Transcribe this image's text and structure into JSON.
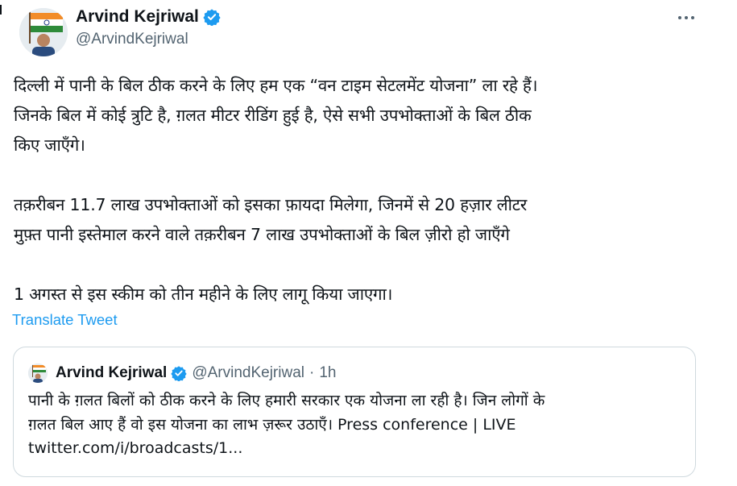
{
  "author": {
    "display_name": "Arvind Kejriwal",
    "handle": "@ArvindKejriwal",
    "verified_icon": "verified-badge-icon"
  },
  "more_icon": "more-options-icon",
  "tweet": {
    "lines": [
      "दिल्ली में पानी के बिल ठीक करने के लिए हम एक “वन टाइम सेटलमेंट योजना” ला रहे हैं।",
      "जिनके बिल में कोई त्रुटि है, ग़लत मीटर रीडिंग हुई है, ऐसे सभी उपभोक्ताओं के बिल ठीक",
      "किए जाएँगे।",
      "",
      "तक़रीबन 11.7 लाख उपभोक्ताओं को इसका फ़ायदा मिलेगा, जिनमें से 20 हज़ार लीटर",
      "मुफ़्त पानी इस्तेमाल करने वाले तक़रीबन 7 लाख उपभोक्ताओं के बिल ज़ीरो हो जाएँगे",
      "",
      "1 अगस्त से इस स्कीम को तीन महीने के लिए लागू किया जाएगा।"
    ],
    "translate_label": "Translate Tweet"
  },
  "quoted": {
    "display_name": "Arvind Kejriwal",
    "handle": "@ArvindKejriwal",
    "separator": "·",
    "time": "1h",
    "lines": [
      "पानी के ग़लत बिलों को ठीक करने के लिए हमारी सरकार एक योजना ला रही है। जिन लोगों के",
      "ग़लत बिल आए हैं वो इस योजना का लाभ ज़रूर उठाएँ। Press conference | LIVE",
      "twitter.com/i/broadcasts/1..."
    ]
  },
  "colors": {
    "text": "#0f1419",
    "secondary": "#536471",
    "link": "#1d9bf0",
    "border": "#cfd9de"
  }
}
